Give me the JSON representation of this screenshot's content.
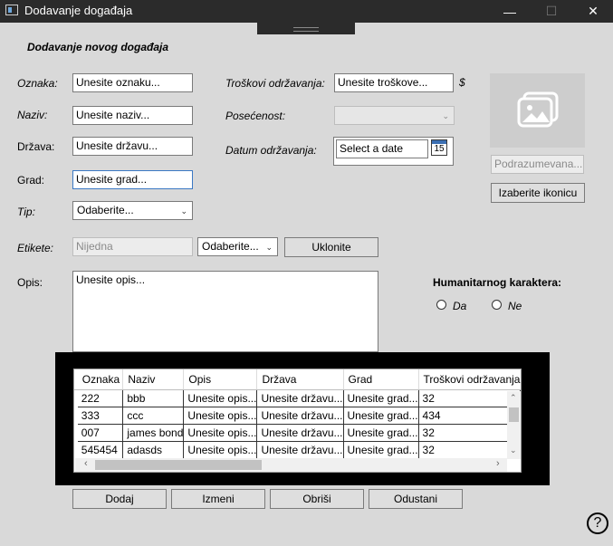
{
  "window": {
    "title": "Dodavanje događaja",
    "minimize": "—",
    "maximize": "☐",
    "close": "✕"
  },
  "form_title": "Dodavanje novog događaja",
  "fields": {
    "oznaka": {
      "label": "Oznaka:",
      "placeholder": "Unesite oznaku..."
    },
    "naziv": {
      "label": "Naziv:",
      "placeholder": "Unesite naziv..."
    },
    "drzava": {
      "label": "Država:",
      "placeholder": "Unesite državu..."
    },
    "grad": {
      "label": "Grad:",
      "placeholder": "Unesite grad..."
    },
    "tip": {
      "label": "Tip:",
      "value": "Odaberite..."
    },
    "troskovi": {
      "label": "Troškovi održavanja:",
      "placeholder": "Unesite troškove...",
      "currency": "$"
    },
    "posecenost": {
      "label": "Posećenost:",
      "value": ""
    },
    "datum": {
      "label": "Datum održavanja:",
      "placeholder": "Select a date",
      "calendar_day": "15"
    },
    "etikete": {
      "label": "Etikete:",
      "value": "Nijedna",
      "select": "Odaberite...",
      "remove_button": "Uklonite"
    },
    "opis": {
      "label": "Opis:",
      "placeholder": "Unesite opis..."
    }
  },
  "icon_panel": {
    "default_text": "Podrazumevana...",
    "choose_button": "Izaberite ikonicu"
  },
  "humanitarian": {
    "label": "Humanitarnog karaktera:",
    "yes": "Da",
    "no": "Ne"
  },
  "table": {
    "columns": [
      "Oznaka",
      "Naziv",
      "Opis",
      "Država",
      "Grad",
      "Troškovi održavanja"
    ],
    "rows": [
      [
        "222",
        "bbb",
        "Unesite opis...",
        "Unesite državu...",
        "Unesite grad...",
        "32"
      ],
      [
        "333",
        "ccc",
        "Unesite opis...",
        "Unesite državu...",
        "Unesite grad...",
        "434"
      ],
      [
        "007",
        "james bond",
        "Unesite opis...",
        "Unesite državu...",
        "Unesite grad...",
        "32"
      ],
      [
        "545454",
        "adasds",
        "Unesite opis...",
        "Unesite državu...",
        "Unesite grad...",
        "32"
      ]
    ]
  },
  "actions": {
    "add": "Dodaj",
    "edit": "Izmeni",
    "delete": "Obriši",
    "cancel": "Odustani"
  },
  "help": "?"
}
